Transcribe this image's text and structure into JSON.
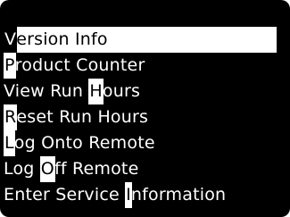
{
  "menu": {
    "items": [
      {
        "label": "Version Info",
        "hotkey_index": 0,
        "selected": true
      },
      {
        "label": "Product Counter",
        "hotkey_index": 0,
        "selected": false
      },
      {
        "label": "View Run Hours",
        "hotkey_index": 9,
        "selected": false
      },
      {
        "label": "Reset Run Hours",
        "hotkey_index": 0,
        "selected": false
      },
      {
        "label": "Log Onto Remote",
        "hotkey_index": 0,
        "selected": false
      },
      {
        "label": "Log Off Remote",
        "hotkey_index": 4,
        "selected": false
      },
      {
        "label": "Enter Service Information",
        "hotkey_index": 14,
        "selected": false
      }
    ]
  },
  "colors": {
    "screen_background": "#000000",
    "text": "#ffffff",
    "selection_background": "#ffffff",
    "selection_text": "#000000"
  }
}
